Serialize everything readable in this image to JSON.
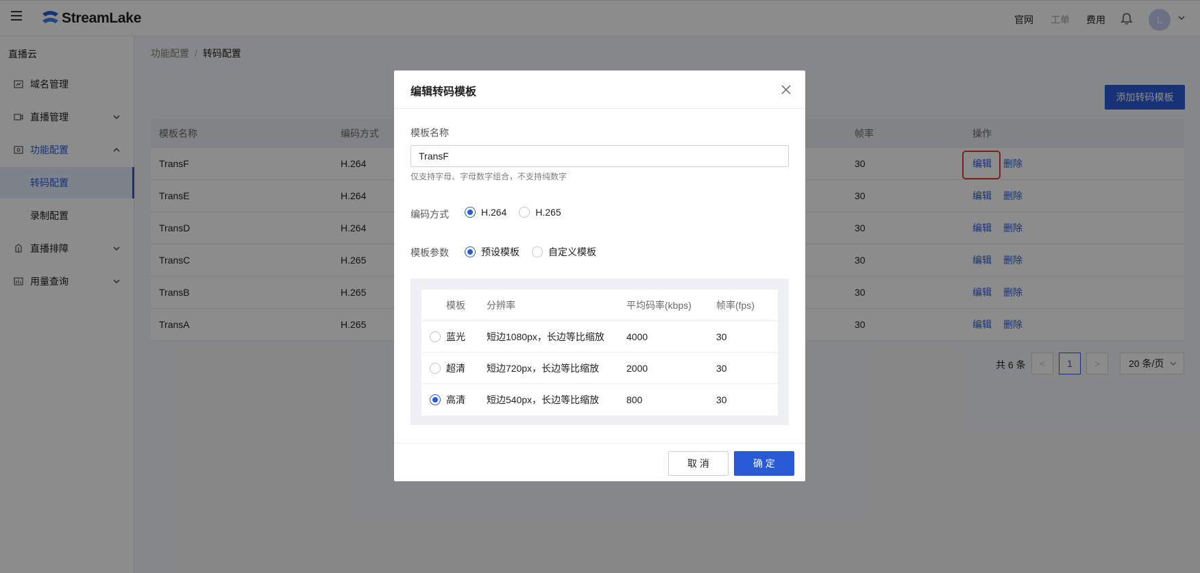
{
  "header": {
    "logo_text": "StreamLake",
    "links": [
      "官网",
      "工单",
      "费用"
    ],
    "avatar_letter": "L"
  },
  "sidebar": {
    "title": "直播云",
    "items": [
      {
        "label": "域名管理",
        "icon": "domain-icon"
      },
      {
        "label": "直播管理",
        "icon": "video-icon",
        "expandable": true
      },
      {
        "label": "功能配置",
        "icon": "config-icon",
        "expandable": true,
        "expanded": true
      },
      {
        "label": "转码配置",
        "sub": true,
        "selected": true
      },
      {
        "label": "录制配置",
        "sub": true
      },
      {
        "label": "直播排障",
        "icon": "troubleshoot-icon",
        "expandable": true
      },
      {
        "label": "用量查询",
        "icon": "usage-icon",
        "expandable": true
      }
    ]
  },
  "breadcrumb": {
    "parent": "功能配置",
    "sep": "/",
    "current": "转码配置"
  },
  "add_button": "添加转码模板",
  "table": {
    "columns": {
      "name": "模板名称",
      "codec": "编码方式",
      "fps": "帧率",
      "ops": "操作"
    },
    "edit_label": "编辑",
    "delete_label": "删除",
    "rows": [
      {
        "name": "TransF",
        "codec": "H.264",
        "fps": "30"
      },
      {
        "name": "TransE",
        "codec": "H.264",
        "fps": "30"
      },
      {
        "name": "TransD",
        "codec": "H.264",
        "fps": "30"
      },
      {
        "name": "TransC",
        "codec": "H.265",
        "fps": "30"
      },
      {
        "name": "TransB",
        "codec": "H.265",
        "fps": "30"
      },
      {
        "name": "TransA",
        "codec": "H.265",
        "fps": "30"
      }
    ]
  },
  "pagination": {
    "total": "共 6 条",
    "prev": "<",
    "current": "1",
    "next": ">",
    "page_size": "20 条/页"
  },
  "modal": {
    "title": "编辑转码模板",
    "name_label": "模板名称",
    "name_value": "TransF",
    "name_hint": "仅支持字母、字母数字组合，不支持纯数字",
    "codec_label": "编码方式",
    "codec_options": [
      "H.264",
      "H.265"
    ],
    "codec_selected": "H.264",
    "param_label": "模板参数",
    "param_options": [
      "预设模板",
      "自定义模板"
    ],
    "param_selected": "预设模板",
    "preset_table": {
      "headers": [
        "模板",
        "分辨率",
        "平均码率(kbps)",
        "帧率(fps)"
      ],
      "rows": [
        {
          "name": "蓝光",
          "res": "短边1080px，长边等比缩放",
          "bitrate": "4000",
          "fps": "30",
          "selected": false
        },
        {
          "name": "超清",
          "res": "短边720px，长边等比缩放",
          "bitrate": "2000",
          "fps": "30",
          "selected": false
        },
        {
          "name": "高清",
          "res": "短边540px，长边等比缩放",
          "bitrate": "800",
          "fps": "30",
          "selected": true
        }
      ]
    },
    "cancel_label": "取 消",
    "ok_label": "确 定"
  },
  "colors": {
    "accent": "#2a5bd7",
    "highlight_border": "#e23b3b"
  }
}
